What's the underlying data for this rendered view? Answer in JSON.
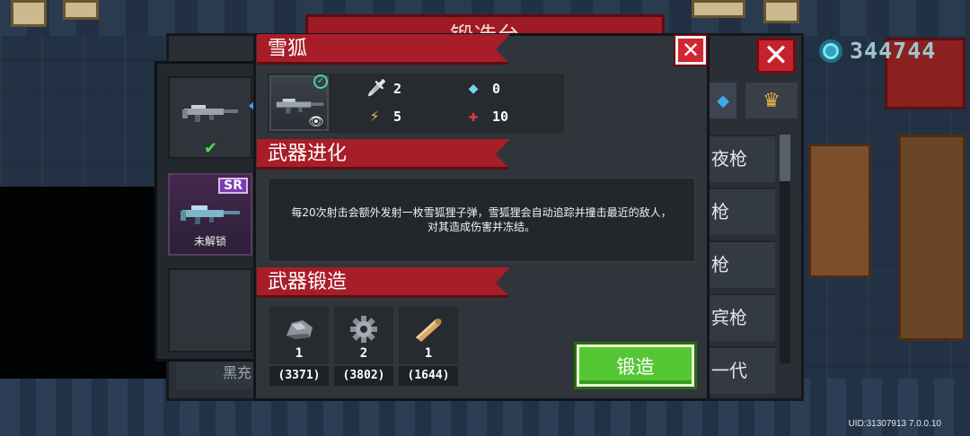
{
  "background": {
    "forge_title": "锻造台",
    "currency_value": "344744",
    "list_items": [
      "夜枪",
      "枪",
      "枪",
      "宾枪",
      "一代"
    ],
    "bottom_item": "黑充"
  },
  "weapon_slots": [
    {
      "state": "selected",
      "check_icon": "✔"
    },
    {
      "rarity": "SR",
      "status": "未解锁"
    },
    {
      "state": "empty"
    }
  ],
  "weapon": {
    "name": "雪狐",
    "stats": {
      "damage": "2",
      "energy": "0",
      "crit": "5",
      "accuracy": "10"
    }
  },
  "evolution": {
    "title": "武器进化",
    "description_line1": "每20次射击会额外发射一枚雪狐狸子弹，雪狐狸会自动追踪并撞击最近的敌人，",
    "description_line2": "对其造成伤害并冻结。"
  },
  "forge": {
    "title": "武器锻造",
    "materials": [
      {
        "icon": "ore-icon",
        "required": "1",
        "owned": "(3371)"
      },
      {
        "icon": "gear-icon",
        "required": "2",
        "owned": "(3802)"
      },
      {
        "icon": "wood-icon",
        "required": "1",
        "owned": "(1644)"
      }
    ],
    "button_label": "锻造"
  },
  "uid_text": "UID:31307913 7.0.0.10",
  "colors": {
    "ribbon": "#a71d28",
    "forge_button": "#55c634",
    "close_button": "#d02832",
    "gem": "#2fa2bf"
  }
}
